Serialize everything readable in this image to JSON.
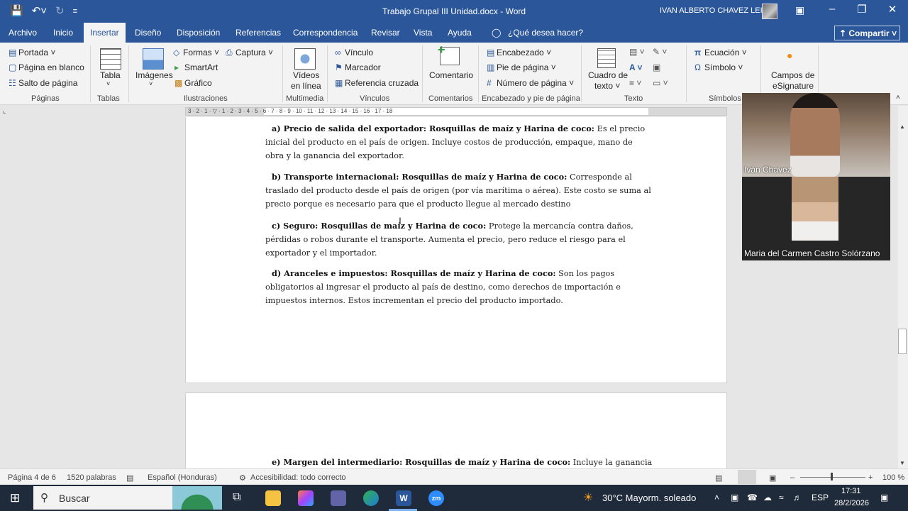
{
  "titlebar": {
    "doc_title": "Trabajo Grupal III Unidad.docx  -  Word",
    "user_name": "IVAN ALBERTO CHAVEZ LEIVA"
  },
  "tabs": [
    {
      "label": "Archivo"
    },
    {
      "label": "Inicio"
    },
    {
      "label": "Insertar"
    },
    {
      "label": "Diseño"
    },
    {
      "label": "Disposición"
    },
    {
      "label": "Referencias"
    },
    {
      "label": "Correspondencia"
    },
    {
      "label": "Revisar"
    },
    {
      "label": "Vista"
    },
    {
      "label": "Ayuda"
    },
    {
      "label": "¿Qué desea hacer?"
    }
  ],
  "share_label": "Compartir",
  "ribbon": {
    "portada": "Portada",
    "pagina_blanco": "Página en blanco",
    "salto_pagina": "Salto de página",
    "paginas_group": "Páginas",
    "tabla": "Tabla",
    "tablas_group": "Tablas",
    "imagenes": "Imágenes",
    "formas": "Formas",
    "captura": "Captura",
    "smartart": "SmartArt",
    "grafico": "Gráfico",
    "ilustraciones_group": "Ilustraciones",
    "videos_line1": "Vídeos",
    "videos_line2": "en línea",
    "multimedia_group": "Multimedia",
    "vinculo": "Vínculo",
    "marcador": "Marcador",
    "referencia_cruzada": "Referencia cruzada",
    "vinculos_group": "Vínculos",
    "comentario": "Comentario",
    "comentarios_group": "Comentarios",
    "encabezado": "Encabezado",
    "pie_pagina": "Pie de página",
    "numero_pagina": "Número de página",
    "encabezado_group": "Encabezado y pie de página",
    "cuadro_line1": "Cuadro de",
    "cuadro_line2": "texto",
    "texto_group": "Texto",
    "ecuacion": "Ecuación",
    "simbolo": "Símbolo",
    "simbolos_group": "Símbolos",
    "campos_line1": "Campos de",
    "campos_line2": "eSignature"
  },
  "ruler_numbers": "3 · 2 · 1 · ▽ · 1 · 2 · 3 · 4 · 5 · 6 · 7 · 8 · 9 · 10 · 11 · 12 · 13 · 14 · 15 · 16 · 17 · 18",
  "document": {
    "paragraphs": [
      {
        "heading": "a) Precio de salida del exportador: Rosquillas de maíz y Harina de coco:",
        "body": " Es el precio inicial del producto en el país de origen. Incluye costos de producción, empaque, mano de obra y la ganancia del exportador."
      },
      {
        "heading": "b) Transporte internacional: Rosquillas de maíz y Harina de coco:",
        "body": " Corresponde al traslado del producto desde el país de origen (por vía marítima o aérea). Este costo se suma al precio porque es necesario para que el producto llegue al mercado destino"
      },
      {
        "heading": "c) Seguro: Rosquillas de maíz y Harina de coco:",
        "body": " Protege la mercancía contra daños, pérdidas o robos durante el transporte. Aumenta el precio, pero reduce el riesgo para el exportador y el importador."
      },
      {
        "heading": "d) Aranceles e impuestos: Rosquillas de maíz y Harina de coco:",
        "body": " Son los pagos obligatorios al ingresar el producto al país de destino, como derechos de importación e impuestos internos. Estos incrementan el precio del producto importado."
      },
      {
        "heading": "e) Margen del intermediario: Rosquillas de maíz y Harina de coco:",
        "body": " Incluye la ganancia"
      }
    ]
  },
  "video": {
    "participant1": "Iván Chavez",
    "participant2": "Maria del Carmen Castro Solórzano"
  },
  "statusbar": {
    "page": "Página 4 de 6",
    "words": "1520 palabras",
    "language": "Español (Honduras)",
    "accessibility": "Accesibilidad: todo correcto",
    "zoom": "100 %"
  },
  "taskbar": {
    "search_placeholder": "Buscar",
    "weather": "30°C  Mayorm. soleado",
    "lang": "ESP",
    "time": "17:31",
    "date": "28/2/2026"
  }
}
